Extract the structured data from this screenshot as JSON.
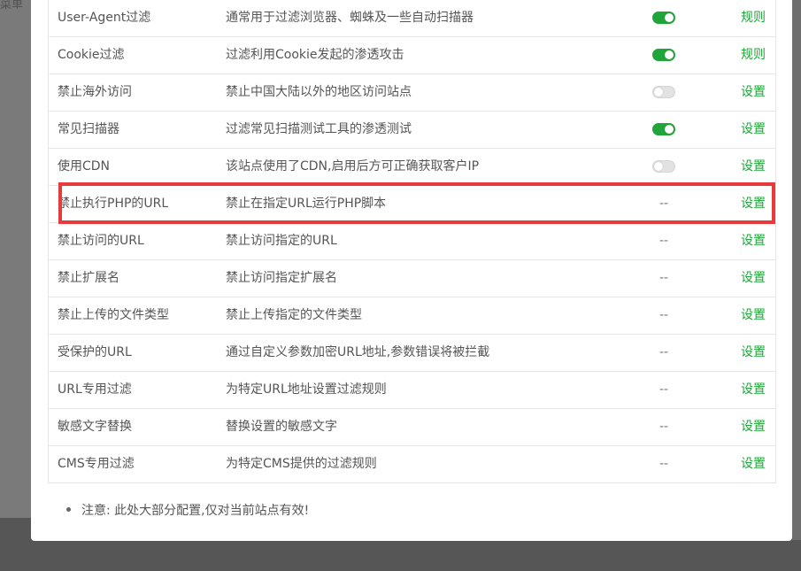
{
  "background": {
    "partial_text": "菜单"
  },
  "table": {
    "rows": [
      {
        "name": "User-Agent过滤",
        "desc": "通常用于过滤浏览器、蜘蛛及一些自动扫描器",
        "status": "toggle-on",
        "action": "规则"
      },
      {
        "name": "Cookie过滤",
        "desc": "过滤利用Cookie发起的渗透攻击",
        "status": "toggle-on",
        "action": "规则"
      },
      {
        "name": "禁止海外访问",
        "desc": "禁止中国大陆以外的地区访问站点",
        "status": "toggle-off",
        "action": "设置"
      },
      {
        "name": "常见扫描器",
        "desc": "过滤常见扫描测试工具的渗透测试",
        "status": "toggle-on",
        "action": "设置"
      },
      {
        "name": "使用CDN",
        "desc": "该站点使用了CDN,启用后方可正确获取客户IP",
        "status": "toggle-off",
        "action": "设置"
      },
      {
        "name": "禁止执行PHP的URL",
        "desc": "禁止在指定URL运行PHP脚本",
        "status": "--",
        "action": "设置"
      },
      {
        "name": "禁止访问的URL",
        "desc": "禁止访问指定的URL",
        "status": "--",
        "action": "设置"
      },
      {
        "name": "禁止扩展名",
        "desc": "禁止访问指定扩展名",
        "status": "--",
        "action": "设置"
      },
      {
        "name": "禁止上传的文件类型",
        "desc": "禁止上传指定的文件类型",
        "status": "--",
        "action": "设置"
      },
      {
        "name": "受保护的URL",
        "desc": "通过自定义参数加密URL地址,参数错误将被拦截",
        "status": "--",
        "action": "设置"
      },
      {
        "name": "URL专用过滤",
        "desc": "为特定URL地址设置过滤规则",
        "status": "--",
        "action": "设置"
      },
      {
        "name": "敏感文字替换",
        "desc": "替换设置的敏感文字",
        "status": "--",
        "action": "设置"
      },
      {
        "name": "CMS专用过滤",
        "desc": "为特定CMS提供的过滤规则",
        "status": "--",
        "action": "设置"
      }
    ]
  },
  "note": "注意: 此处大部分配置,仅对当前站点有效!",
  "colors": {
    "accent": "#20a53a",
    "highlight": "#e8393b",
    "toggle_off": "#e2e2e2"
  }
}
